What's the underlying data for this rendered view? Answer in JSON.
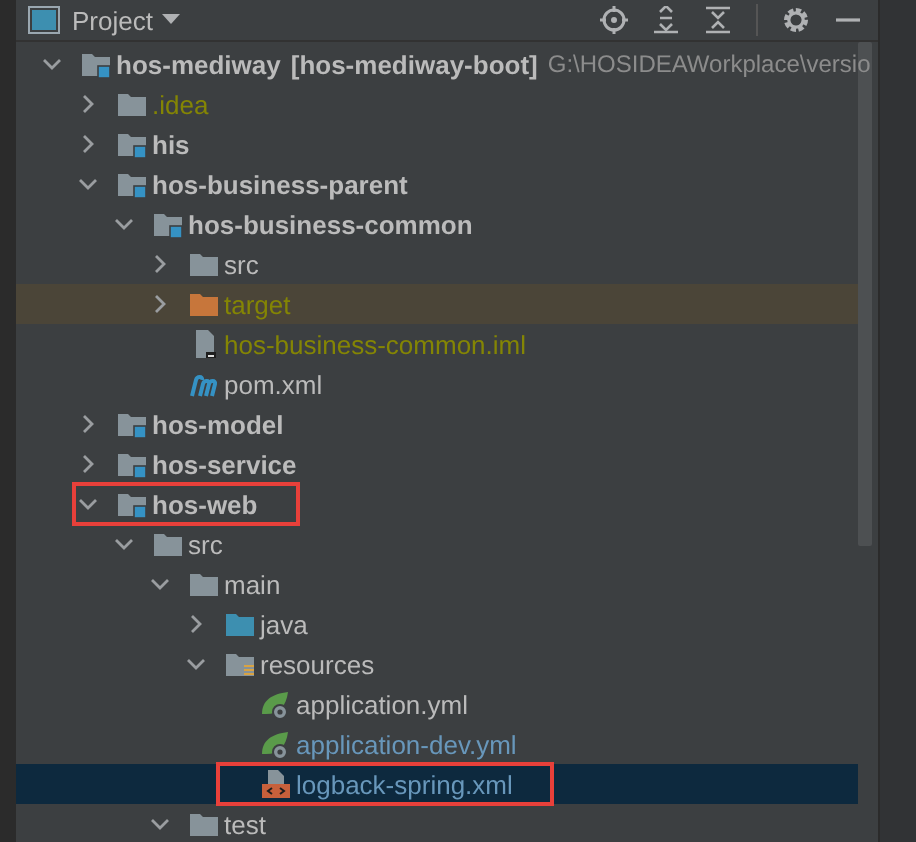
{
  "panel": {
    "title": "Project"
  },
  "tree": [
    {
      "kind": "module",
      "name": "hos-mediway",
      "module_name": "[hos-mediway-boot]",
      "path": "G:\\HOSIDEAWorkplace\\versio",
      "color": "#bbbbbb",
      "expanded": true,
      "selected": false,
      "highlighted": false,
      "marked": false,
      "children": [
        {
          "kind": "folder-excluded",
          "name": ".idea",
          "color": "#848504",
          "expanded": false,
          "selected": false,
          "highlighted": false,
          "marked": false
        },
        {
          "kind": "module",
          "name": "his",
          "color": "#bbbbbb",
          "expanded": false,
          "selected": false,
          "highlighted": false,
          "marked": false
        },
        {
          "kind": "module",
          "name": "hos-business-parent",
          "color": "#bbbbbb",
          "expanded": true,
          "selected": false,
          "highlighted": false,
          "marked": false,
          "children": [
            {
              "kind": "module",
              "name": "hos-business-common",
              "color": "#bbbbbb",
              "expanded": true,
              "selected": false,
              "highlighted": false,
              "marked": false,
              "children": [
                {
                  "kind": "folder",
                  "name": "src",
                  "color": "#bbbbbb",
                  "expanded": false,
                  "selected": false,
                  "highlighted": false,
                  "marked": false
                },
                {
                  "kind": "folder-target",
                  "name": "target",
                  "color": "#848504",
                  "expanded": false,
                  "selected": false,
                  "highlighted": true,
                  "marked": false
                },
                {
                  "kind": "iml",
                  "name": "hos-business-common.iml",
                  "color": "#848504",
                  "selected": false,
                  "highlighted": false,
                  "marked": false
                },
                {
                  "kind": "maven",
                  "name": "pom.xml",
                  "color": "#bbbbbb",
                  "selected": false,
                  "highlighted": false,
                  "marked": false
                }
              ]
            }
          ]
        },
        {
          "kind": "module",
          "name": "hos-model",
          "color": "#bbbbbb",
          "expanded": false,
          "selected": false,
          "highlighted": false,
          "marked": false
        },
        {
          "kind": "module",
          "name": "hos-service",
          "color": "#bbbbbb",
          "expanded": false,
          "selected": false,
          "highlighted": false,
          "marked": false
        },
        {
          "kind": "module",
          "name": "hos-web",
          "color": "#bbbbbb",
          "expanded": true,
          "selected": false,
          "highlighted": false,
          "marked": true,
          "children": [
            {
              "kind": "folder",
              "name": "src",
              "color": "#bbbbbb",
              "expanded": true,
              "selected": false,
              "highlighted": false,
              "marked": false,
              "children": [
                {
                  "kind": "folder",
                  "name": "main",
                  "color": "#bbbbbb",
                  "expanded": true,
                  "selected": false,
                  "highlighted": false,
                  "marked": false,
                  "children": [
                    {
                      "kind": "folder-source",
                      "name": "java",
                      "color": "#bbbbbb",
                      "expanded": false,
                      "selected": false,
                      "highlighted": false,
                      "marked": false
                    },
                    {
                      "kind": "folder-resources",
                      "name": "resources",
                      "color": "#bbbbbb",
                      "expanded": true,
                      "selected": false,
                      "highlighted": false,
                      "marked": false,
                      "children": [
                        {
                          "kind": "spring",
                          "name": "application.yml",
                          "color": "#bbbbbb",
                          "selected": false,
                          "highlighted": false,
                          "marked": false
                        },
                        {
                          "kind": "spring",
                          "name": "application-dev.yml",
                          "color": "#6897bb",
                          "selected": false,
                          "highlighted": false,
                          "marked": false
                        },
                        {
                          "kind": "xml",
                          "name": "logback-spring.xml",
                          "color": "#6897bb",
                          "selected": true,
                          "highlighted": false,
                          "marked": true
                        }
                      ]
                    }
                  ]
                },
                {
                  "kind": "folder",
                  "name": "test",
                  "color": "#bbbbbb",
                  "expanded": true,
                  "selected": false,
                  "highlighted": false,
                  "marked": false
                }
              ]
            }
          ]
        }
      ]
    }
  ]
}
